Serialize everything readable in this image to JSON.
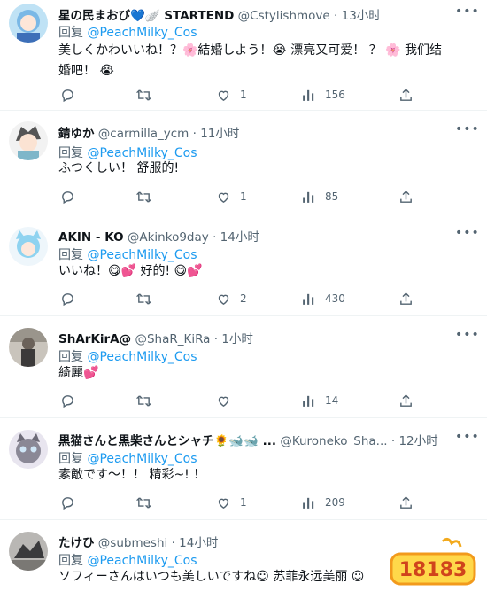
{
  "reply_prefix": "回复",
  "tweets": [
    {
      "name": "星の民まおび💙🪽 STARTEND",
      "handle": "@Cstylishmove",
      "dot": "·",
      "time": "13小时",
      "mention": "@PeachMilky_Cos",
      "text": "美しくかわいいね！？🌸結婚しよう！😭 漂亮又可爱！ ？ 🌸 我们结婚吧！ 😭",
      "replies": "",
      "retweets": "",
      "likes": "1",
      "views": "156"
    },
    {
      "name": "錆ゆか",
      "handle": "@carmilla_ycm",
      "dot": "·",
      "time": "11小时",
      "mention": "@PeachMilky_Cos",
      "text": "ふつくしい！ 舒服的!",
      "replies": "",
      "retweets": "",
      "likes": "1",
      "views": "85"
    },
    {
      "name": "AKIN - KO",
      "handle": "@Akinko9day",
      "dot": "·",
      "time": "14小时",
      "mention": "@PeachMilky_Cos",
      "text": "いいね！😋💕 好的! 😋💕",
      "replies": "",
      "retweets": "",
      "likes": "2",
      "views": "430"
    },
    {
      "name": "ShArKirA@",
      "handle": "@ShaR_KiRa",
      "dot": "·",
      "time": "1小时",
      "mention": "@PeachMilky_Cos",
      "text": "綺麗💕",
      "replies": "",
      "retweets": "",
      "likes": "",
      "views": "14"
    },
    {
      "name": "黒猫さんと黒柴さんとシャチ🌻🐋🐋 ...",
      "handle": "@Kuroneko_Sha...",
      "dot": "·",
      "time": "12小时",
      "mention": "@PeachMilky_Cos",
      "text": "素敵です～！！ 精彩~! ！",
      "replies": "",
      "retweets": "",
      "likes": "1",
      "views": "209"
    },
    {
      "name": "たけひ",
      "handle": "@submeshi",
      "dot": "·",
      "time": "14小时",
      "mention": "@PeachMilky_Cos",
      "text": "ソフィーさんはいつも美しいですね☺ 苏菲永远美丽 ☺",
      "replies": "",
      "retweets": "",
      "likes": "",
      "views": ""
    }
  ],
  "watermark": {
    "text": "18183"
  },
  "colors": {
    "link": "#1d9bf0",
    "muted": "#536471",
    "text": "#0f1419"
  }
}
